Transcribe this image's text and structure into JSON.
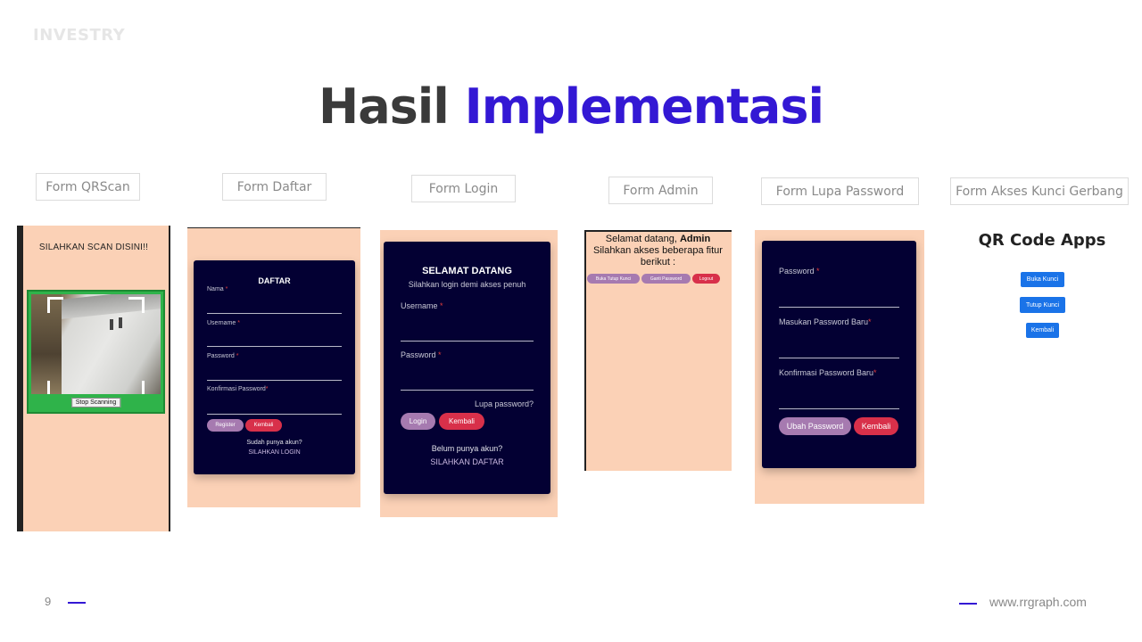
{
  "brand": "INVESTRY",
  "title": {
    "part1": "Hasil",
    "part2": "Implementasi"
  },
  "labels": {
    "qrscan": "Form  QRScan",
    "daftar": "Form  Daftar",
    "login": "Form  Login",
    "admin": "Form  Admin",
    "lupa": "Form  Lupa Password",
    "akses": "Form  Akses Kunci Gerbang"
  },
  "qrscan": {
    "heading": "SILAHKAN SCAN DISINI!!",
    "stop_button": "Stop Scanning"
  },
  "daftar": {
    "heading": "DAFTAR",
    "fields": [
      "Nama",
      "Username",
      "Password",
      "Konfirmasi Password"
    ],
    "required_mark": "*",
    "register_button": "Register",
    "kembali_button": "Kembali",
    "account_prompt": "Sudah punya akun?",
    "login_link": "SILAHKAN LOGIN"
  },
  "login": {
    "heading": "SELAMAT DATANG",
    "subheading": "Silahkan login demi akses penuh",
    "username_label": "Username",
    "password_label": "Password",
    "required_mark": "*",
    "forgot_link": "Lupa password?",
    "login_button": "Login",
    "kembali_button": "Kembali",
    "account_prompt": "Belum punya akun?",
    "register_link": "SILAHKAN DAFTAR"
  },
  "admin": {
    "greeting_prefix": "Selamat datang,",
    "greeting_name": "Admin",
    "line2": "Silahkan akses beberapa fitur",
    "line3": "berikut :",
    "buttons": [
      "Buka Tutup Kunci",
      "Ganti Password",
      "Logout"
    ]
  },
  "lupa": {
    "fields": [
      "Password",
      "Masukan Password Baru",
      "Konfirmasi Password Baru"
    ],
    "required_mark": "*",
    "ubah_button": "Ubah Password",
    "kembali_button": "Kembali"
  },
  "qrapps": {
    "title": "QR Code Apps",
    "buttons": [
      "Buka Kunci",
      "Tutup Kunci",
      "Kembali"
    ]
  },
  "footer": {
    "page_number": "9",
    "website": "www.rrgraph.com"
  },
  "colors": {
    "accent": "#3318d4",
    "peach": "#fbd1b6",
    "navy": "#030033",
    "purple_button": "#a67ab0",
    "red_button": "#d8304a",
    "blue_button": "#1a73e8"
  }
}
